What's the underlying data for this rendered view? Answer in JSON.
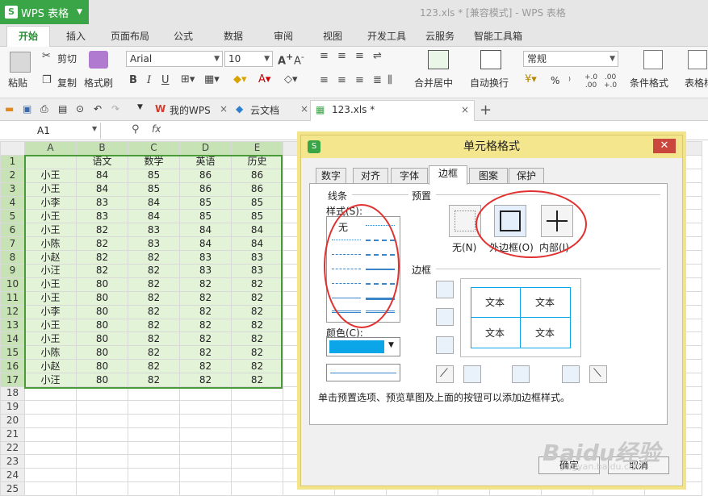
{
  "app": {
    "name": "WPS 表格",
    "window_title": "123.xls * [兼容模式] - WPS 表格"
  },
  "ribbon_tabs": [
    "开始",
    "插入",
    "页面布局",
    "公式",
    "数据",
    "审阅",
    "视图",
    "开发工具",
    "云服务",
    "智能工具箱"
  ],
  "ribbon": {
    "paste": "粘贴",
    "cut": "剪切",
    "copy": "复制",
    "format_painter": "格式刷",
    "font_name": "Arial",
    "font_size": "10",
    "merge_center": "合并居中",
    "wrap_text": "自动换行",
    "number_format": "常规",
    "percent": "%",
    "comma": "⁾",
    "conditional_format": "条件格式",
    "table_style": "表格样"
  },
  "doc_tabs": {
    "wps": "我的WPS",
    "cloud": "云文档",
    "file": "123.xls *"
  },
  "formula": {
    "name_box": "A1",
    "fx": "fx"
  },
  "sheet": {
    "columns": [
      "A",
      "B",
      "C",
      "D",
      "E"
    ],
    "header": [
      "",
      "语文",
      "数学",
      "英语",
      "历史"
    ],
    "rows": [
      [
        "小王",
        "84",
        "85",
        "86",
        "86"
      ],
      [
        "小王",
        "84",
        "85",
        "86",
        "86"
      ],
      [
        "小李",
        "83",
        "84",
        "85",
        "85"
      ],
      [
        "小王",
        "83",
        "84",
        "85",
        "85"
      ],
      [
        "小王",
        "82",
        "83",
        "84",
        "84"
      ],
      [
        "小陈",
        "82",
        "83",
        "84",
        "84"
      ],
      [
        "小赵",
        "82",
        "82",
        "83",
        "83"
      ],
      [
        "小汪",
        "82",
        "82",
        "83",
        "83"
      ],
      [
        "小王",
        "80",
        "82",
        "82",
        "82"
      ],
      [
        "小王",
        "80",
        "82",
        "82",
        "82"
      ],
      [
        "小李",
        "80",
        "82",
        "82",
        "82"
      ],
      [
        "小王",
        "80",
        "82",
        "82",
        "82"
      ],
      [
        "小王",
        "80",
        "82",
        "82",
        "82"
      ],
      [
        "小陈",
        "80",
        "82",
        "82",
        "82"
      ],
      [
        "小赵",
        "80",
        "82",
        "82",
        "82"
      ],
      [
        "小汪",
        "80",
        "82",
        "82",
        "82"
      ]
    ],
    "row_numbers": [
      "1",
      "2",
      "3",
      "4",
      "5",
      "6",
      "7",
      "8",
      "9",
      "10",
      "11",
      "12",
      "13",
      "14",
      "15",
      "16",
      "17",
      "18",
      "19",
      "20",
      "21",
      "22",
      "23",
      "24",
      "25"
    ]
  },
  "dialog": {
    "title": "单元格格式",
    "tabs": [
      "数字",
      "对齐",
      "字体",
      "边框",
      "图案",
      "保护"
    ],
    "active_tab": "边框",
    "line_group": "线条",
    "style_label": "样式(S):",
    "style_none": "无",
    "color_label": "颜色(C):",
    "color_value": "#0aa6e8",
    "preset_group": "预置",
    "preset_none": "无(N)",
    "preset_outline": "外边框(O)",
    "preset_inside": "内部(I)",
    "border_group": "边框",
    "preview_text": [
      "文本",
      "文本",
      "文本",
      "文本"
    ],
    "hint": "单击预置选项、预览草图及上面的按钮可以添加边框样式。",
    "ok": "确定",
    "cancel": "取消"
  },
  "watermark": {
    "brand": "Baidu经验",
    "url": "jingyan.baidu.com"
  }
}
